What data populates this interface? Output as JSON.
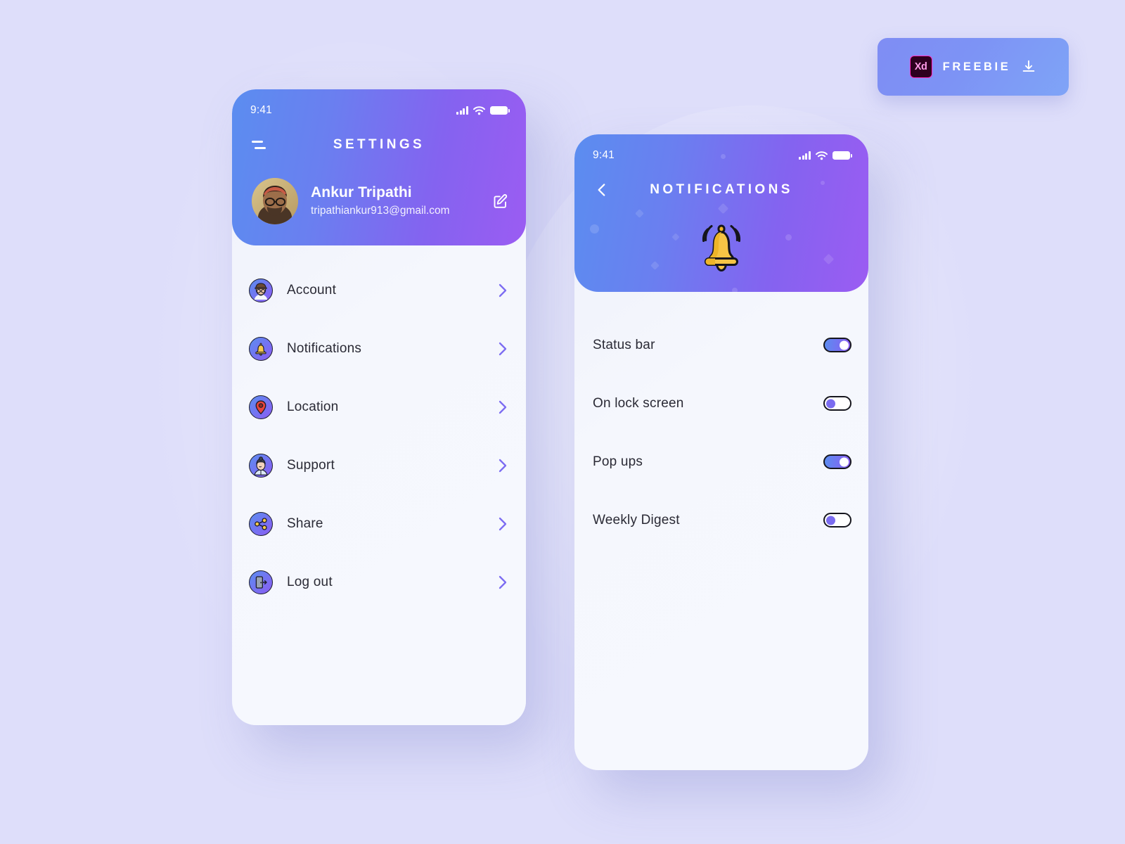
{
  "background": {
    "color": "#DEDEFA"
  },
  "badge": {
    "name": "freebie-badge",
    "logo_text": "Xd",
    "label": "FREEBIE",
    "download_icon": "download-icon",
    "accent": "#FF2BC2",
    "bg": "#7F8DF4"
  },
  "phones": {
    "settings": {
      "status_bar": {
        "time": "9:41",
        "signal_icon": "signal-icon",
        "wifi_icon": "wifi-icon",
        "battery_icon": "battery-icon"
      },
      "header": {
        "menu_icon": "hamburger-icon",
        "title": "SETTINGS",
        "gradient_from": "#5B8DF0",
        "gradient_to": "#9B5CF2"
      },
      "profile": {
        "avatar_icon": "avatar",
        "name": "Ankur Tripathi",
        "email": "tripathiankur913@gmail.com",
        "edit_icon": "edit-icon"
      },
      "list": [
        {
          "label": "Account",
          "icon": "account-avatar-icon",
          "chevron": "chevron-right-icon"
        },
        {
          "label": "Notifications",
          "icon": "bell-icon",
          "chevron": "chevron-right-icon"
        },
        {
          "label": "Location",
          "icon": "location-pin-icon",
          "chevron": "chevron-right-icon"
        },
        {
          "label": "Support",
          "icon": "support-agent-icon",
          "chevron": "chevron-right-icon"
        },
        {
          "label": "Share",
          "icon": "share-icon",
          "chevron": "chevron-right-icon"
        },
        {
          "label": "Log out",
          "icon": "logout-door-icon",
          "chevron": "chevron-right-icon"
        }
      ]
    },
    "notifications": {
      "status_bar": {
        "time": "9:41",
        "signal_icon": "signal-icon",
        "wifi_icon": "wifi-icon",
        "battery_icon": "battery-icon"
      },
      "header": {
        "back_icon": "chevron-left-icon",
        "title": "NOTIFICATIONS",
        "hero_icon": "ringing-bell-icon",
        "gradient_from": "#5B8DF0",
        "gradient_to": "#9B5CF2"
      },
      "toggles": [
        {
          "label": "Status bar",
          "state": "on"
        },
        {
          "label": "On lock screen",
          "state": "off"
        },
        {
          "label": "Pop ups",
          "state": "on"
        },
        {
          "label": "Weekly Digest",
          "state": "off"
        }
      ]
    }
  }
}
